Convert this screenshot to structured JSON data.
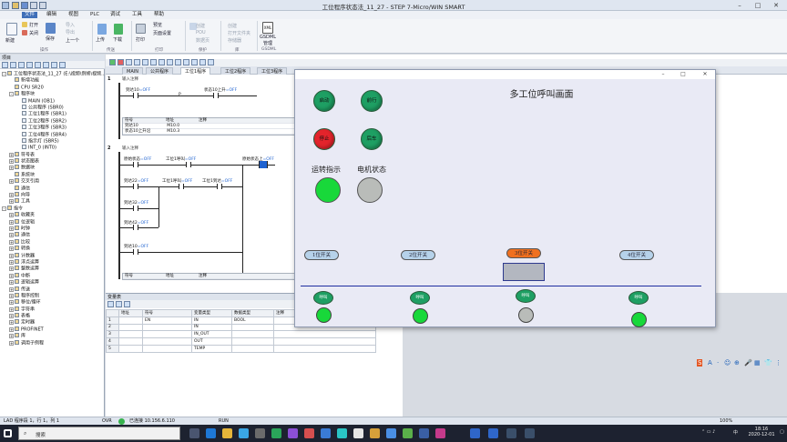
{
  "window": {
    "title": "工位程序状态法_11_27 - STEP 7-Micro/WIN SMART"
  },
  "menu": [
    "文件",
    "编辑",
    "视图",
    "PLC",
    "调试",
    "工具",
    "帮助"
  ],
  "menu_active": 0,
  "ribbon": {
    "new": "新建",
    "open": "打开",
    "close": "关闭",
    "save": "保存",
    "import": "导入",
    "export": "导出",
    "previous": "上一个",
    "upload": "上传",
    "download": "下载",
    "print": "打印",
    "preview": "预览",
    "page_setup": "页面设置",
    "create": "创建",
    "pou": "POU",
    "datablock": "数据页",
    "open_folder": "打开文件夹",
    "memory_card": "存储器",
    "gsdml": "GSDML",
    "gsdml_manage": "管理",
    "groups": [
      "操作",
      "传送",
      "打印",
      "保护",
      "库",
      "GSDML"
    ]
  },
  "leftpanel": {
    "header": "项目",
    "tree": [
      {
        "label": "工位程序状态法_11_27 (E:\\视频\\例修\\视频...",
        "depth": 0,
        "expand": "-"
      },
      {
        "label": "新增功能",
        "depth": 1,
        "expand": ""
      },
      {
        "label": "CPU SR20",
        "depth": 1,
        "expand": ""
      },
      {
        "label": "程序块",
        "depth": 1,
        "expand": "-"
      },
      {
        "label": "MAIN (OB1)",
        "depth": 2,
        "expand": ""
      },
      {
        "label": "公共程序 (SBR0)",
        "depth": 2,
        "expand": ""
      },
      {
        "label": "工位1程序 (SBR1)",
        "depth": 2,
        "expand": ""
      },
      {
        "label": "工位2程序 (SBR2)",
        "depth": 2,
        "expand": ""
      },
      {
        "label": "工位3程序 (SBR3)",
        "depth": 2,
        "expand": ""
      },
      {
        "label": "工位4程序 (SBR4)",
        "depth": 2,
        "expand": ""
      },
      {
        "label": "指示灯 (SBR5)",
        "depth": 2,
        "expand": ""
      },
      {
        "label": "INT_0 (INT0)",
        "depth": 2,
        "expand": ""
      },
      {
        "label": "符号表",
        "depth": 1,
        "expand": "+"
      },
      {
        "label": "状态图表",
        "depth": 1,
        "expand": "+"
      },
      {
        "label": "数据块",
        "depth": 1,
        "expand": "+"
      },
      {
        "label": "系统块",
        "depth": 1,
        "expand": ""
      },
      {
        "label": "交叉引用",
        "depth": 1,
        "expand": "+"
      },
      {
        "label": "通信",
        "depth": 1,
        "expand": ""
      },
      {
        "label": "向导",
        "depth": 1,
        "expand": "+"
      },
      {
        "label": "工具",
        "depth": 1,
        "expand": "+"
      },
      {
        "label": "指令",
        "depth": 0,
        "expand": "-"
      },
      {
        "label": "收藏夹",
        "depth": 1,
        "expand": "+"
      },
      {
        "label": "位逻辑",
        "depth": 1,
        "expand": "+"
      },
      {
        "label": "时钟",
        "depth": 1,
        "expand": "+"
      },
      {
        "label": "通信",
        "depth": 1,
        "expand": "+"
      },
      {
        "label": "比较",
        "depth": 1,
        "expand": "+"
      },
      {
        "label": "转换",
        "depth": 1,
        "expand": "+"
      },
      {
        "label": "计数器",
        "depth": 1,
        "expand": "+"
      },
      {
        "label": "浮点运算",
        "depth": 1,
        "expand": "+"
      },
      {
        "label": "整数运算",
        "depth": 1,
        "expand": "+"
      },
      {
        "label": "中断",
        "depth": 1,
        "expand": "+"
      },
      {
        "label": "逻辑运算",
        "depth": 1,
        "expand": "+"
      },
      {
        "label": "传送",
        "depth": 1,
        "expand": "+"
      },
      {
        "label": "程序控制",
        "depth": 1,
        "expand": "+"
      },
      {
        "label": "移位/循环",
        "depth": 1,
        "expand": "+"
      },
      {
        "label": "字符串",
        "depth": 1,
        "expand": "+"
      },
      {
        "label": "表格",
        "depth": 1,
        "expand": "+"
      },
      {
        "label": "定时器",
        "depth": 1,
        "expand": "+"
      },
      {
        "label": "PROFINET",
        "depth": 1,
        "expand": "+"
      },
      {
        "label": "库",
        "depth": 1,
        "expand": "+"
      },
      {
        "label": "调用子例程",
        "depth": 1,
        "expand": "+"
      }
    ]
  },
  "editor": {
    "tabs": [
      "MAIN",
      "公共程序",
      "工位1程序",
      "工位2程序",
      "工位3程序"
    ],
    "selected_tab": 2,
    "net1": {
      "num": "1",
      "comment": "输入注释",
      "contact1": "到达10",
      "contact1_state": "=OFF",
      "p_label": "P",
      "contact2": "状态10上升",
      "contact2_state": "=OFF",
      "sym_head": [
        "符号",
        "地址",
        "注释"
      ],
      "sym_rows": [
        [
          "到达10",
          "M10.0",
          ""
        ],
        [
          "状态10上升沿",
          "M10.3",
          ""
        ]
      ]
    },
    "net2": {
      "num": "2",
      "comment": "输入注释",
      "c_a": "原始状态",
      "c_a_state": "=OFF",
      "c_b": "工位1呼叫",
      "c_b_state": "=OFF",
      "c_c": "原始状态上",
      "c_c_state": "=OFF",
      "c_d": "到达22",
      "c_d_state": "=OFF",
      "c_e": "工位1呼叫",
      "c_e_state": "=OFF",
      "c_f": "工位1到达",
      "c_f_state": "=OFF",
      "c_g": "到达32",
      "c_g_state": "=OFF",
      "c_h": "到达42",
      "c_h_state": "=OFF",
      "c_i": "到达10",
      "c_i_state": "=OFF",
      "sym_head": [
        "符号",
        "地址",
        "注释"
      ]
    }
  },
  "varpanel": {
    "header": "变量表",
    "columns": [
      "地址",
      "符号",
      "变量类型",
      "数据类型",
      "注释"
    ],
    "rows": [
      [
        "1",
        "",
        "EN",
        "IN",
        "BOOL",
        ""
      ],
      [
        "2",
        "",
        "",
        "IN",
        "",
        ""
      ],
      [
        "3",
        "",
        "",
        "IN_OUT",
        "",
        ""
      ],
      [
        "4",
        "",
        "",
        "OUT",
        "",
        ""
      ],
      [
        "5",
        "",
        "",
        "TEMP",
        "",
        ""
      ]
    ]
  },
  "hmi": {
    "title": "多工位呼叫画面",
    "start": "启动",
    "stop": "停止",
    "forward": "前行",
    "back": "后车",
    "run_label": "运转指示",
    "motor_label": "电机状态",
    "colors": {
      "btn_green": "#1e9f63",
      "btn_red": "#e3242b",
      "lamp_on": "#18d83a",
      "lamp_off": "#b9bcb9",
      "pill_orange": "#f07020",
      "pill_blue": "#b6d2ea"
    },
    "stations": [
      {
        "switch": "1位开关",
        "call": "呼叫",
        "lamp_on": true
      },
      {
        "switch": "2位开关",
        "call": "呼叫",
        "lamp_on": true
      },
      {
        "switch": "3位开关",
        "call": "呼叫",
        "lamp_on": false
      },
      {
        "switch": "4位开关",
        "call": "呼叫",
        "lamp_on": true
      }
    ]
  },
  "statusbar": {
    "lad": "LAD 程序段 1，行 1，列 1",
    "ovr": "OVR",
    "conn": "已连接 10.156.6.110",
    "run": "RUN",
    "zoom": "100%"
  },
  "taskbar": {
    "search": "搜索",
    "time": "18:16",
    "date": "2020-12-01",
    "lang": "中"
  },
  "ime": [
    "S",
    "A",
    "·",
    "☺",
    "⊕",
    "🎤",
    "▦",
    "👕",
    "⋮"
  ]
}
